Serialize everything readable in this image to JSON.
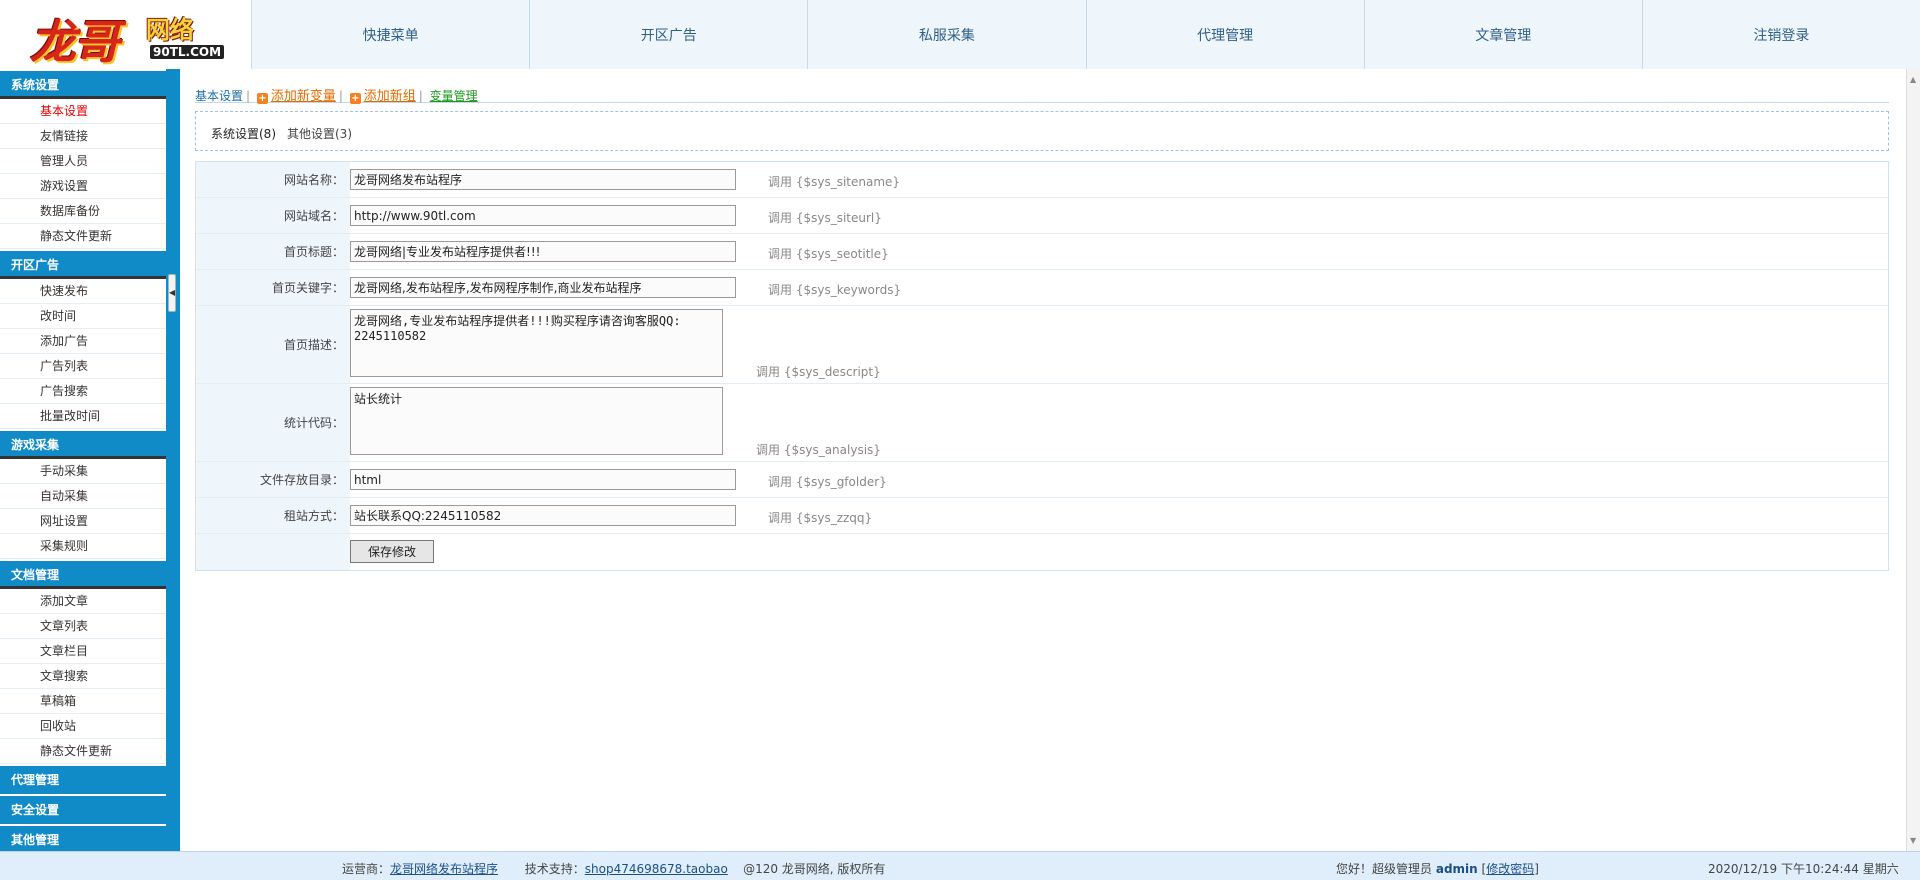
{
  "logo": {
    "main": "龙哥",
    "sub": "网络",
    "url": "90TL.COM"
  },
  "topnav": [
    "快捷菜单",
    "开区广告",
    "私服采集",
    "代理管理",
    "文章管理",
    "注销登录"
  ],
  "sidebar": {
    "sections": [
      {
        "title": "系统设置",
        "items": [
          "基本设置",
          "友情链接",
          "管理人员",
          "游戏设置",
          "数据库备份",
          "静态文件更新"
        ]
      },
      {
        "title": "开区广告",
        "items": [
          "快速发布",
          "改时间",
          "添加广告",
          "广告列表",
          "广告搜索",
          "批量改时间"
        ]
      },
      {
        "title": "游戏采集",
        "items": [
          "手动采集",
          "自动采集",
          "网址设置",
          "采集规则"
        ]
      },
      {
        "title": "文档管理",
        "items": [
          "添加文章",
          "文章列表",
          "文章栏目",
          "文章搜索",
          "草稿箱",
          "回收站",
          "静态文件更新"
        ]
      },
      {
        "title": "代理管理",
        "items": []
      },
      {
        "title": "安全设置",
        "items": []
      },
      {
        "title": "其他管理",
        "items": []
      }
    ],
    "active_item": "基本设置"
  },
  "topbar": {
    "basic": "基本设置",
    "add_var": "添加新变量",
    "add_group": "添加新组",
    "var_manage": "变量管理",
    "sep": "|"
  },
  "tabs": {
    "active": "系统设置(8)",
    "other": "其他设置(3)"
  },
  "form": {
    "rows": [
      {
        "label": "网站名称：",
        "value": "龙哥网络发布站程序",
        "hint": "调用 {$sys_sitename}"
      },
      {
        "label": "网站域名：",
        "value": "http://www.90tl.com",
        "hint": "调用 {$sys_siteurl}"
      },
      {
        "label": "首页标题：",
        "value": "龙哥网络|专业发布站程序提供者!!!",
        "hint": "调用 {$sys_seotitle}"
      },
      {
        "label": "首页关键字：",
        "value": "龙哥网络,发布站程序,发布网程序制作,商业发布站程序",
        "hint": "调用 {$sys_keywords}"
      },
      {
        "label": "首页描述：",
        "value": "龙哥网络,专业发布站程序提供者!!!购买程序请咨询客服QQ: 2245110582",
        "hint": "调用 {$sys_descript}"
      },
      {
        "label": "统计代码：",
        "value": "站长统计",
        "hint": "调用 {$sys_analysis}"
      },
      {
        "label": "文件存放目录：",
        "value": "html",
        "hint": "调用 {$sys_gfolder}"
      },
      {
        "label": "租站方式：",
        "value": "站长联系QQ:2245110582",
        "hint": "调用 {$sys_zzqq}"
      }
    ],
    "save_label": "保存修改"
  },
  "footer": {
    "operator_label": "运营商：",
    "operator_link": "龙哥网络发布站程序",
    "support_label": "技术支持：",
    "support_link": "shop474698678.taobao",
    "copyright": "@120 龙哥网络, 版权所有",
    "greeting": "您好！超级管理员",
    "admin": "admin",
    "bracket_open": "[",
    "change_pwd": "修改密码",
    "bracket_close": "]",
    "datetime": "2020/12/19 下午10:24:44 星期六"
  },
  "colors": {
    "accent": "#118bc7",
    "nav_bg": "#eef5fb",
    "active_red": "#e60000"
  }
}
